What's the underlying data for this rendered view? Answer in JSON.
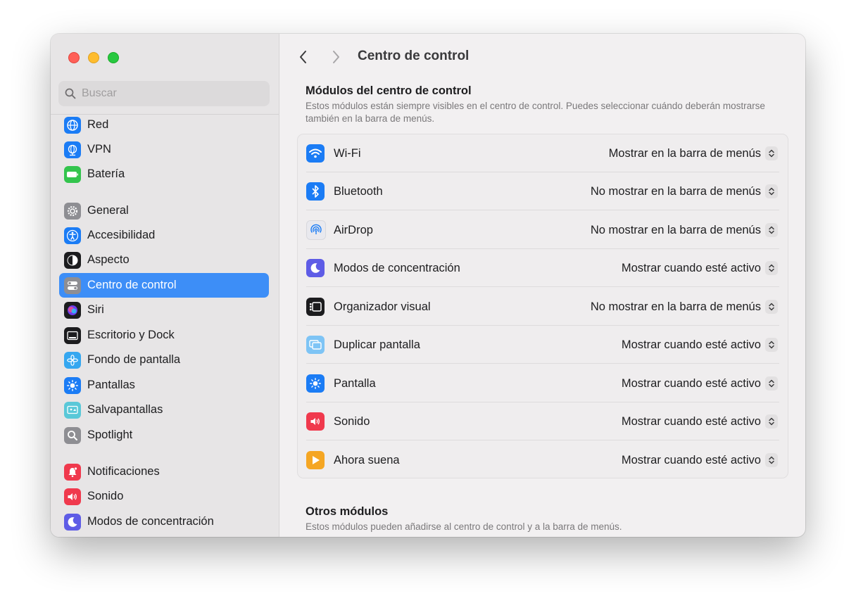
{
  "window": {
    "title": "Centro de control"
  },
  "search": {
    "placeholder": "Buscar"
  },
  "sidebar": {
    "items": [
      {
        "label": "Red",
        "icon": "globe-icon",
        "color": "#1b7cf5",
        "active": false
      },
      {
        "label": "VPN",
        "icon": "vpn-globe-icon",
        "color": "#1b7cf5",
        "active": false
      },
      {
        "label": "Batería",
        "icon": "battery-icon",
        "color": "#33c44d",
        "active": false
      },
      {
        "label": "General",
        "icon": "gear-icon",
        "color": "#8e8e93",
        "active": false
      },
      {
        "label": "Accesibilidad",
        "icon": "accessibility-icon",
        "color": "#1b7cf5",
        "active": false
      },
      {
        "label": "Aspecto",
        "icon": "appearance-icon",
        "color": "#1c1c1e",
        "active": false
      },
      {
        "label": "Centro de control",
        "icon": "toggles-icon",
        "color": "#8e8e93",
        "active": true
      },
      {
        "label": "Siri",
        "icon": "siri-icon",
        "color": "#1c1c1e",
        "active": false
      },
      {
        "label": "Escritorio y Dock",
        "icon": "dock-icon",
        "color": "#1c1c1e",
        "active": false
      },
      {
        "label": "Fondo de pantalla",
        "icon": "flower-icon",
        "color": "#35a7f0",
        "active": false
      },
      {
        "label": "Pantallas",
        "icon": "sun-icon",
        "color": "#1b7cf5",
        "active": false
      },
      {
        "label": "Salvapantallas",
        "icon": "screensaver-icon",
        "color": "#5ac8d8",
        "active": false
      },
      {
        "label": "Spotlight",
        "icon": "magnifier-icon",
        "color": "#8e8e93",
        "active": false
      },
      {
        "label": "Notificaciones",
        "icon": "bell-icon",
        "color": "#f0394d",
        "active": false
      },
      {
        "label": "Sonido",
        "icon": "speaker-icon",
        "color": "#f0394d",
        "active": false
      },
      {
        "label": "Modos de concentración",
        "icon": "moon-icon",
        "color": "#5e5ce6",
        "active": false
      }
    ]
  },
  "modules": {
    "title": "Módulos del centro de control",
    "description": "Estos módulos están siempre visibles en el centro de control. Puedes seleccionar cuándo deberán mostrarse también en la barra de menús.",
    "rows": [
      {
        "label": "Wi-Fi",
        "value": "Mostrar en la barra de menús",
        "icon": "wifi-icon",
        "color": "#1b7cf5"
      },
      {
        "label": "Bluetooth",
        "value": "No mostrar en la barra de menús",
        "icon": "bluetooth-icon",
        "color": "#1b7cf5"
      },
      {
        "label": "AirDrop",
        "value": "No mostrar en la barra de menús",
        "icon": "airdrop-icon",
        "color": "#e9e9ee"
      },
      {
        "label": "Modos de concentración",
        "value": "Mostrar cuando esté activo",
        "icon": "moon-icon",
        "color": "#5e5ce6"
      },
      {
        "label": "Organizador visual",
        "value": "No mostrar en la barra de menús",
        "icon": "stage-manager-icon",
        "color": "#1c1c1e"
      },
      {
        "label": "Duplicar pantalla",
        "value": "Mostrar cuando esté activo",
        "icon": "screen-mirroring-icon",
        "color": "#7ec4f5"
      },
      {
        "label": "Pantalla",
        "value": "Mostrar cuando esté activo",
        "icon": "sun-icon",
        "color": "#1b7cf5"
      },
      {
        "label": "Sonido",
        "value": "Mostrar cuando esté activo",
        "icon": "speaker-icon",
        "color": "#f0394d"
      },
      {
        "label": "Ahora suena",
        "value": "Mostrar cuando esté activo",
        "icon": "play-icon",
        "color": "#f5a623"
      }
    ]
  },
  "other": {
    "title": "Otros módulos",
    "description": "Estos módulos pueden añadirse al centro de control y a la barra de menús."
  }
}
